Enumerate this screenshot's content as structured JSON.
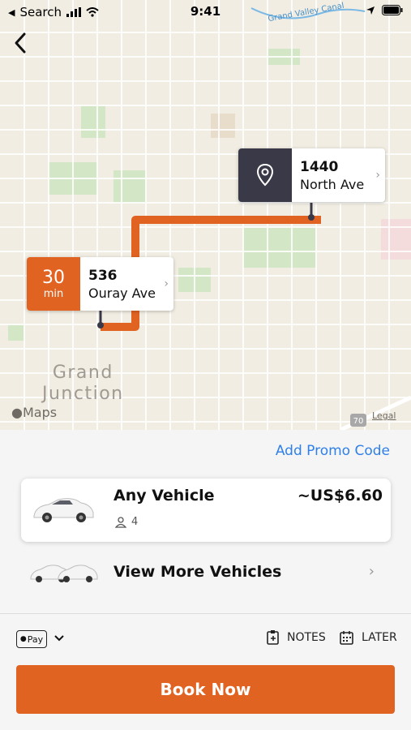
{
  "status_bar": {
    "back_app": "Search",
    "time": "9:41"
  },
  "map": {
    "city_label_line1": "Grand",
    "city_label_line2": "Junction",
    "brand": "Maps",
    "legal": "Legal",
    "canal_label": "Grand Valley Canal",
    "highway_label": "70"
  },
  "destination": {
    "number": "1440",
    "street": "North Ave",
    "icon": "location-pin-icon"
  },
  "pickup": {
    "eta_value": "30",
    "eta_unit": "min",
    "number": "536",
    "street": "Ouray Ave"
  },
  "promo_label": "Add Promo Code",
  "vehicle": {
    "name": "Any Vehicle",
    "price": "~US$6.60",
    "capacity": "4"
  },
  "more_vehicles_label": "View More Vehicles",
  "payment": {
    "method": "Pay"
  },
  "options": {
    "notes_label": "NOTES",
    "later_label": "LATER"
  },
  "book_label": "Book Now",
  "colors": {
    "accent": "#e06322",
    "link": "#2f80e8",
    "pin_badge": "#3a3948"
  }
}
